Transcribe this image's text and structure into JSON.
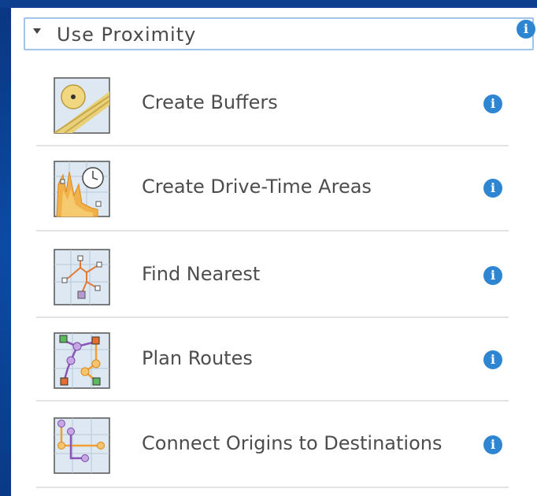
{
  "panel": {
    "section_title": "Use Proximity",
    "tools": [
      {
        "label": "Create Buffers",
        "icon": "create-buffers-icon"
      },
      {
        "label": "Create Drive-Time Areas",
        "icon": "create-drive-time-areas-icon"
      },
      {
        "label": "Find Nearest",
        "icon": "find-nearest-icon"
      },
      {
        "label": "Plan Routes",
        "icon": "plan-routes-icon"
      },
      {
        "label": "Connect Origins to Destinations",
        "icon": "connect-origins-icon"
      }
    ],
    "info_glyph": "i"
  },
  "colors": {
    "background": "#0c3f8a",
    "header_border": "#9fc3ea",
    "info_blue": "#2e86d3",
    "divider": "#e3e3e3",
    "text": "#4d4d4d"
  }
}
